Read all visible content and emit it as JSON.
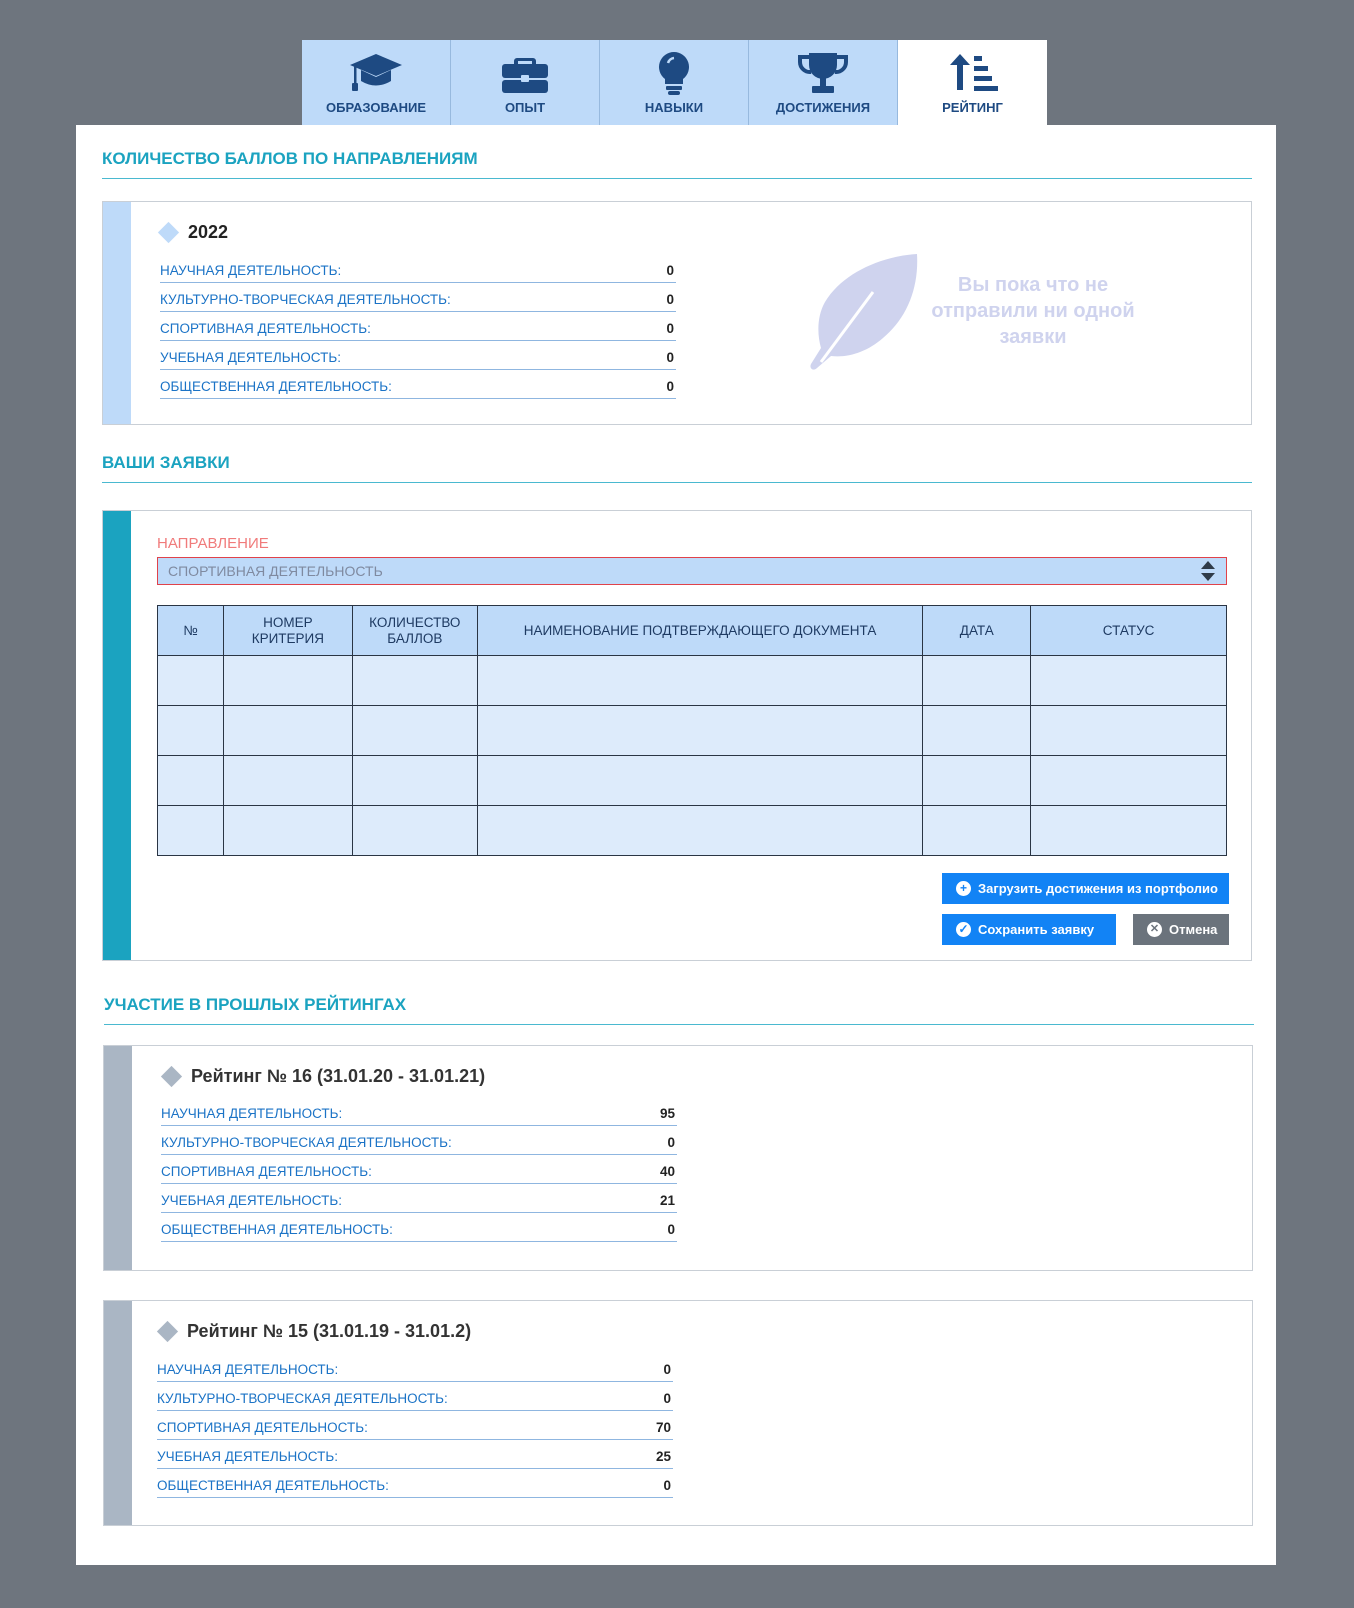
{
  "tabs": [
    {
      "label": "ОБРАЗОВАНИЕ",
      "icon": "graduation-cap-icon"
    },
    {
      "label": "ОПЫТ",
      "icon": "briefcase-icon"
    },
    {
      "label": "НАВЫКИ",
      "icon": "lightbulb-icon"
    },
    {
      "label": "ДОСТИЖЕНИЯ",
      "icon": "trophy-icon"
    },
    {
      "label": "РЕЙТИНГ",
      "icon": "sort-ascending-icon",
      "active": true
    }
  ],
  "scores_section": {
    "title": "КОЛИЧЕСТВО БАЛЛОВ ПО НАПРАВЛЕНИЯМ",
    "year": "2022",
    "rows": [
      {
        "label": "НАУЧНАЯ ДЕЯТЕЛЬНОСТЬ:",
        "value": "0"
      },
      {
        "label": "КУЛЬТУРНО-ТВОРЧЕСКАЯ ДЕЯТЕЛЬНОСТЬ:",
        "value": "0"
      },
      {
        "label": "СПОРТИВНАЯ ДЕЯТЕЛЬНОСТЬ:",
        "value": "0"
      },
      {
        "label": "УЧЕБНАЯ ДЕЯТЕЛЬНОСТЬ:",
        "value": "0"
      },
      {
        "label": "ОБЩЕСТВЕННАЯ ДЕЯТЕЛЬНОСТЬ:",
        "value": "0"
      }
    ],
    "empty_message": "Вы пока что не отправили ни одной заявки"
  },
  "requests_section": {
    "title": "ВАШИ ЗАЯВКИ",
    "direction_label": "НАПРАВЛЕНИЕ",
    "direction_value": "СПОРТИВНАЯ ДЕЯТЕЛЬНОСТЬ",
    "columns": [
      "№",
      "НОМЕР КРИТЕРИЯ",
      "КОЛИЧЕСТВО БАЛЛОВ",
      "НАИМЕНОВАНИЕ ПОДТВЕРЖДАЮЩЕГО ДОКУМЕНТА",
      "ДАТА",
      "СТАТУС"
    ],
    "rows": [
      [
        "",
        "",
        "",
        "",
        "",
        ""
      ],
      [
        "",
        "",
        "",
        "",
        "",
        ""
      ],
      [
        "",
        "",
        "",
        "",
        "",
        ""
      ],
      [
        "",
        "",
        "",
        "",
        "",
        ""
      ]
    ],
    "load_button": "Загрузить достижения из портфолио",
    "save_button": "Сохранить заявку",
    "cancel_button": "Отмена"
  },
  "past_section": {
    "title": "УЧАСТИЕ В ПРОШЛЫХ РЕЙТИНГАХ",
    "ratings": [
      {
        "title": "Рейтинг № 16 (31.01.20 - 31.01.21)",
        "rows": [
          {
            "label": "НАУЧНАЯ ДЕЯТЕЛЬНОСТЬ:",
            "value": "95"
          },
          {
            "label": "КУЛЬТУРНО-ТВОРЧЕСКАЯ ДЕЯТЕЛЬНОСТЬ:",
            "value": "0"
          },
          {
            "label": "СПОРТИВНАЯ ДЕЯТЕЛЬНОСТЬ:",
            "value": "40"
          },
          {
            "label": "УЧЕБНАЯ ДЕЯТЕЛЬНОСТЬ:",
            "value": "21"
          },
          {
            "label": "ОБЩЕСТВЕННАЯ ДЕЯТЕЛЬНОСТЬ:",
            "value": "0"
          }
        ]
      },
      {
        "title": "Рейтинг № 15 (31.01.19 - 31.01.2)",
        "rows": [
          {
            "label": "НАУЧНАЯ ДЕЯТЕЛЬНОСТЬ:",
            "value": "0"
          },
          {
            "label": "КУЛЬТУРНО-ТВОРЧЕСКАЯ ДЕЯТЕЛЬНОСТЬ:",
            "value": "0"
          },
          {
            "label": "СПОРТИВНАЯ ДЕЯТЕЛЬНОСТЬ:",
            "value": "70"
          },
          {
            "label": "УЧЕБНАЯ ДЕЯТЕЛЬНОСТЬ:",
            "value": "25"
          },
          {
            "label": "ОБЩЕСТВЕННАЯ ДЕЯТЕЛЬНОСТЬ:",
            "value": "0"
          }
        ]
      }
    ]
  },
  "colors": {
    "background": "#6e757e",
    "accent_teal": "#1ba3c0",
    "link_blue": "#1b73c6",
    "tab_bg": "#bedaf9",
    "tab_text": "#1e4a82",
    "button_blue": "#1283f5",
    "button_gray": "#6b737c",
    "stripe_light_blue": "#bedaf9",
    "stripe_teal": "#1ba3c0",
    "stripe_gray": "#aab6c4",
    "error_red": "#e0424a"
  }
}
